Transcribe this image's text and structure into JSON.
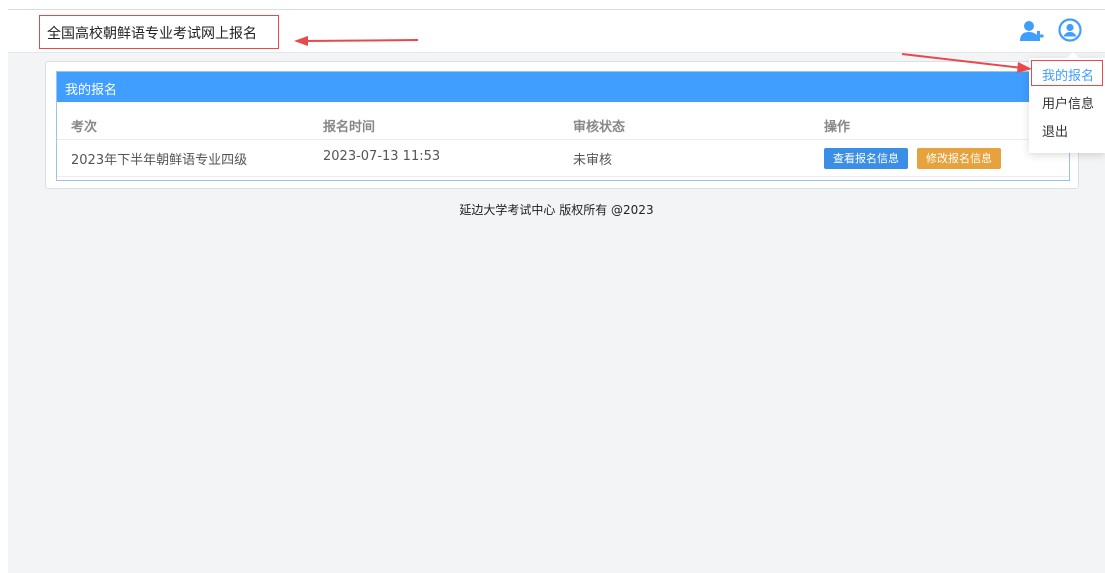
{
  "header": {
    "site_title": "全国高校朝鲜语专业考试网上报名",
    "icons": [
      "user-add-icon",
      "user-circle-icon"
    ]
  },
  "panel": {
    "title": "我的报名",
    "columns": [
      "考次",
      "报名时间",
      "审核状态",
      "操作"
    ],
    "rows": [
      {
        "exam": "2023年下半年朝鲜语专业四级",
        "time": "2023-07-13 11:53",
        "status": "未审核",
        "view_label": "查看报名信息",
        "edit_label": "修改报名信息"
      }
    ]
  },
  "footer": {
    "text": "延边大学考试中心 版权所有 @2023"
  },
  "dropdown": {
    "items": [
      "我的报名",
      "用户信息",
      "退出"
    ],
    "active_index": 0
  },
  "colors": {
    "primary": "#409eff",
    "warning": "#e6a23c",
    "annotation_red": "#e8494a"
  }
}
